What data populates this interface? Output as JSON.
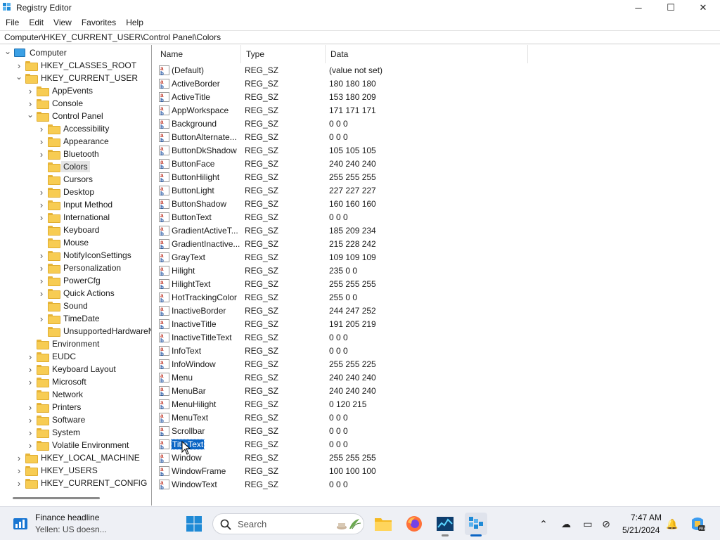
{
  "window": {
    "title": "Registry Editor",
    "controls": {
      "minimize": "─",
      "maximize": "☐",
      "close": "✕"
    }
  },
  "menu": [
    "File",
    "Edit",
    "View",
    "Favorites",
    "Help"
  ],
  "address": "Computer\\HKEY_CURRENT_USER\\Control Panel\\Colors",
  "tree": [
    {
      "label": "Computer",
      "depth": 0,
      "chevron": "expanded",
      "icon": "computer-icon"
    },
    {
      "label": "HKEY_CLASSES_ROOT",
      "depth": 1,
      "chevron": "collapsed"
    },
    {
      "label": "HKEY_CURRENT_USER",
      "depth": 1,
      "chevron": "expanded"
    },
    {
      "label": "AppEvents",
      "depth": 2,
      "chevron": "collapsed"
    },
    {
      "label": "Console",
      "depth": 2,
      "chevron": "collapsed"
    },
    {
      "label": "Control Panel",
      "depth": 2,
      "chevron": "expanded"
    },
    {
      "label": "Accessibility",
      "depth": 3,
      "chevron": "collapsed"
    },
    {
      "label": "Appearance",
      "depth": 3,
      "chevron": "collapsed"
    },
    {
      "label": "Bluetooth",
      "depth": 3,
      "chevron": "collapsed"
    },
    {
      "label": "Colors",
      "depth": 3,
      "chevron": "none",
      "selected": true
    },
    {
      "label": "Cursors",
      "depth": 3,
      "chevron": "none"
    },
    {
      "label": "Desktop",
      "depth": 3,
      "chevron": "collapsed"
    },
    {
      "label": "Input Method",
      "depth": 3,
      "chevron": "collapsed"
    },
    {
      "label": "International",
      "depth": 3,
      "chevron": "collapsed"
    },
    {
      "label": "Keyboard",
      "depth": 3,
      "chevron": "none"
    },
    {
      "label": "Mouse",
      "depth": 3,
      "chevron": "none"
    },
    {
      "label": "NotifyIconSettings",
      "depth": 3,
      "chevron": "collapsed"
    },
    {
      "label": "Personalization",
      "depth": 3,
      "chevron": "collapsed"
    },
    {
      "label": "PowerCfg",
      "depth": 3,
      "chevron": "collapsed"
    },
    {
      "label": "Quick Actions",
      "depth": 3,
      "chevron": "collapsed"
    },
    {
      "label": "Sound",
      "depth": 3,
      "chevron": "none"
    },
    {
      "label": "TimeDate",
      "depth": 3,
      "chevron": "collapsed"
    },
    {
      "label": "UnsupportedHardwareN",
      "depth": 3,
      "chevron": "none"
    },
    {
      "label": "Environment",
      "depth": 2,
      "chevron": "none"
    },
    {
      "label": "EUDC",
      "depth": 2,
      "chevron": "collapsed"
    },
    {
      "label": "Keyboard Layout",
      "depth": 2,
      "chevron": "collapsed"
    },
    {
      "label": "Microsoft",
      "depth": 2,
      "chevron": "collapsed"
    },
    {
      "label": "Network",
      "depth": 2,
      "chevron": "none"
    },
    {
      "label": "Printers",
      "depth": 2,
      "chevron": "collapsed"
    },
    {
      "label": "Software",
      "depth": 2,
      "chevron": "collapsed"
    },
    {
      "label": "System",
      "depth": 2,
      "chevron": "collapsed"
    },
    {
      "label": "Volatile Environment",
      "depth": 2,
      "chevron": "collapsed"
    },
    {
      "label": "HKEY_LOCAL_MACHINE",
      "depth": 1,
      "chevron": "collapsed"
    },
    {
      "label": "HKEY_USERS",
      "depth": 1,
      "chevron": "collapsed"
    },
    {
      "label": "HKEY_CURRENT_CONFIG",
      "depth": 1,
      "chevron": "collapsed"
    }
  ],
  "list": {
    "columns": [
      "Name",
      "Type",
      "Data"
    ],
    "rows": [
      {
        "name": "(Default)",
        "type": "REG_SZ",
        "data": "(value not set)"
      },
      {
        "name": "ActiveBorder",
        "type": "REG_SZ",
        "data": "180 180 180"
      },
      {
        "name": "ActiveTitle",
        "type": "REG_SZ",
        "data": "153 180 209"
      },
      {
        "name": "AppWorkspace",
        "type": "REG_SZ",
        "data": "171 171 171"
      },
      {
        "name": "Background",
        "type": "REG_SZ",
        "data": "0 0 0"
      },
      {
        "name": "ButtonAlternate...",
        "type": "REG_SZ",
        "data": "0 0 0"
      },
      {
        "name": "ButtonDkShadow",
        "type": "REG_SZ",
        "data": "105 105 105"
      },
      {
        "name": "ButtonFace",
        "type": "REG_SZ",
        "data": "240 240 240"
      },
      {
        "name": "ButtonHilight",
        "type": "REG_SZ",
        "data": "255 255 255"
      },
      {
        "name": "ButtonLight",
        "type": "REG_SZ",
        "data": "227 227 227"
      },
      {
        "name": "ButtonShadow",
        "type": "REG_SZ",
        "data": "160 160 160"
      },
      {
        "name": "ButtonText",
        "type": "REG_SZ",
        "data": "0 0 0"
      },
      {
        "name": "GradientActiveT...",
        "type": "REG_SZ",
        "data": "185 209 234"
      },
      {
        "name": "GradientInactive...",
        "type": "REG_SZ",
        "data": "215 228 242"
      },
      {
        "name": "GrayText",
        "type": "REG_SZ",
        "data": "109 109 109"
      },
      {
        "name": "Hilight",
        "type": "REG_SZ",
        "data": "235 0 0"
      },
      {
        "name": "HilightText",
        "type": "REG_SZ",
        "data": "255 255 255"
      },
      {
        "name": "HotTrackingColor",
        "type": "REG_SZ",
        "data": "255 0 0"
      },
      {
        "name": "InactiveBorder",
        "type": "REG_SZ",
        "data": "244 247 252"
      },
      {
        "name": "InactiveTitle",
        "type": "REG_SZ",
        "data": "191 205 219"
      },
      {
        "name": "InactiveTitleText",
        "type": "REG_SZ",
        "data": "0 0 0"
      },
      {
        "name": "InfoText",
        "type": "REG_SZ",
        "data": "0 0 0"
      },
      {
        "name": "InfoWindow",
        "type": "REG_SZ",
        "data": "255 255 225"
      },
      {
        "name": "Menu",
        "type": "REG_SZ",
        "data": "240 240 240"
      },
      {
        "name": "MenuBar",
        "type": "REG_SZ",
        "data": "240 240 240"
      },
      {
        "name": "MenuHilight",
        "type": "REG_SZ",
        "data": "0 120 215"
      },
      {
        "name": "MenuText",
        "type": "REG_SZ",
        "data": "0 0 0"
      },
      {
        "name": "Scrollbar",
        "type": "REG_SZ",
        "data": "0 0 0"
      },
      {
        "name": "TitleText",
        "type": "REG_SZ",
        "data": "0 0 0",
        "selected": true
      },
      {
        "name": "Window",
        "type": "REG_SZ",
        "data": "255 255 255"
      },
      {
        "name": "WindowFrame",
        "type": "REG_SZ",
        "data": "100 100 100"
      },
      {
        "name": "WindowText",
        "type": "REG_SZ",
        "data": "0 0 0"
      }
    ]
  },
  "taskbar": {
    "news": {
      "title": "Finance headline",
      "subtitle": "Yellen: US doesn..."
    },
    "search_placeholder": "Search",
    "apps": [
      "file-explorer-icon",
      "firefox-icon",
      "task-manager-icon",
      "registry-editor-icon"
    ],
    "clock": {
      "time": "7:47 AM",
      "date": "5/21/2024"
    }
  },
  "colors": {
    "selection": "#0a64c4",
    "tree_selection": "#e5e5e5",
    "folder": "#f7cc53"
  }
}
